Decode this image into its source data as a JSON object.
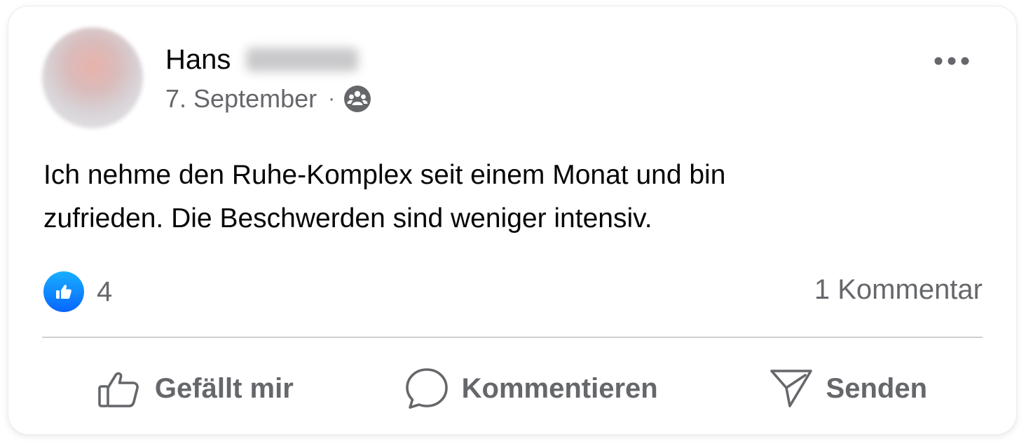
{
  "post": {
    "author_first_name": "Hans",
    "date": "7. September",
    "separator": "·",
    "audience_icon": "group-icon",
    "menu_icon": "more-options-icon",
    "text": "Ich nehme den Ruhe-Komplex seit einem Monat und bin\nzufrieden. Die Beschwerden sind weniger intensiv.",
    "reactions": {
      "icon": "like-reaction-icon",
      "count": "4",
      "color": "#0866ff"
    },
    "comment_count_label": "1 Kommentar"
  },
  "actions": {
    "like": {
      "label": "Gefällt mir",
      "icon": "thumbs-up-icon"
    },
    "comment": {
      "label": "Kommentieren",
      "icon": "comment-bubble-icon"
    },
    "send": {
      "label": "Senden",
      "icon": "send-icon"
    }
  },
  "colors": {
    "text_primary": "#050505",
    "text_secondary": "#65676b",
    "divider": "#ced0d4",
    "accent_blue": "#0866ff"
  }
}
